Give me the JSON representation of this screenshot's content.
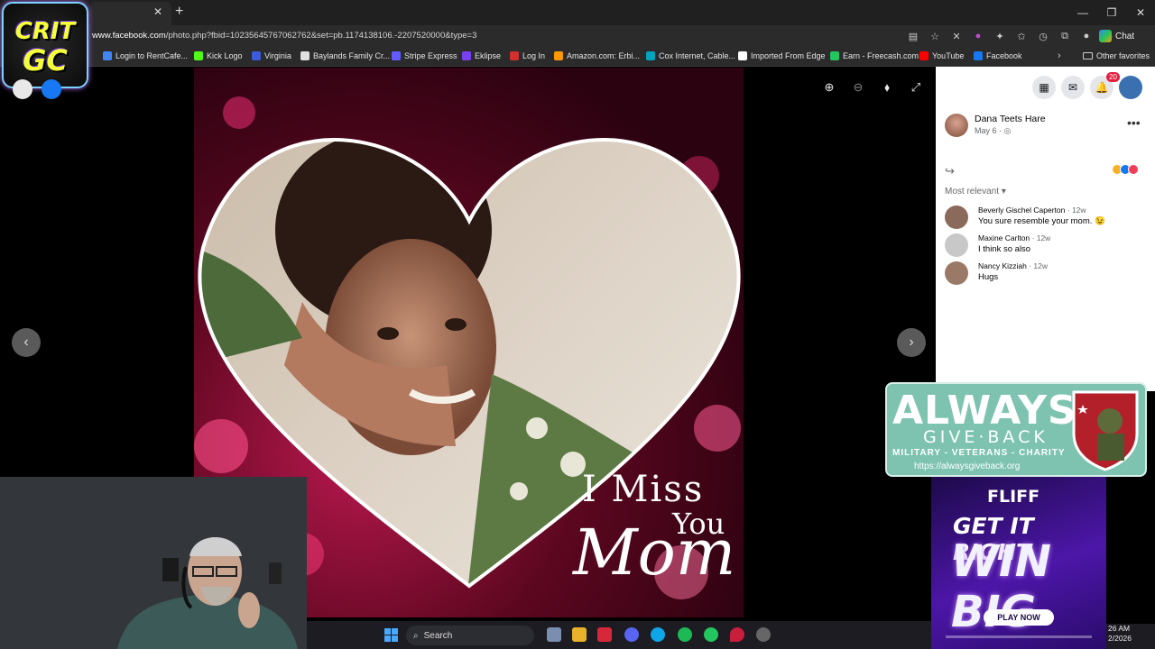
{
  "browser": {
    "url_prefix": "www.facebook.com",
    "url_rest": "/photo.php?fbid=10235645767062762&set=pb.1174138106.-2207520000&type=3",
    "chat_label": "Chat",
    "bookmarks": [
      {
        "label": "Login to RentCafe...",
        "color": "#4285f4"
      },
      {
        "label": "Kick Logo",
        "color": "#53fc18"
      },
      {
        "label": "Virginia",
        "color": "#3b5bdb"
      },
      {
        "label": "Baylands Family Cr...",
        "color": "#e0e0e0"
      },
      {
        "label": "Stripe Express",
        "color": "#635bff"
      },
      {
        "label": "Eklipse",
        "color": "#7b3ff2"
      },
      {
        "label": "Log In",
        "color": "#d32f2f"
      },
      {
        "label": "Amazon.com: Erbi...",
        "color": "#ff9900"
      },
      {
        "label": "Cox Internet, Cable...",
        "color": "#00a4bd"
      },
      {
        "label": "Imported From Edge",
        "color": "#ffffff"
      },
      {
        "label": "Earn - Freecash.com",
        "color": "#22c55e"
      },
      {
        "label": "YouTube",
        "color": "#ff0000"
      },
      {
        "label": "Facebook",
        "color": "#1877f2"
      }
    ],
    "other_favorites": "Other favorites"
  },
  "overlay": {
    "logo_line1": "CRIT",
    "logo_line2": "GC"
  },
  "photo": {
    "line1": "I Miss",
    "line2": "You",
    "line3": "Mom"
  },
  "post": {
    "poster_name": "Dana Teets Hare",
    "date": "May 6 · ",
    "notification_count": "20",
    "sort_label": "Most relevant",
    "comments": [
      {
        "name": "Beverly Gischel Caperton",
        "time": " · 12w",
        "text": "You sure resemble your mom. 😉",
        "avatar": "#8a6a5a"
      },
      {
        "name": "Maxine Carlton",
        "time": " · 12w",
        "text": "I think so also",
        "avatar": "#c8c8c8"
      },
      {
        "name": "Nancy Kizziah",
        "time": " · 12w",
        "text": "Hugs",
        "avatar": "#9a7a66"
      }
    ]
  },
  "ads": {
    "agb_title": "ALWAYS",
    "agb_subtitle": "GIVE·BACK",
    "agb_tagline": "MILITARY - VETERANS - CHARITY",
    "agb_url": "https://alwaysgiveback.org",
    "fliff_logo": "FLIFF",
    "fliff_line1": "GET IT RIGHT",
    "fliff_line2": "WIN BIG",
    "fliff_cta": "PLAY NOW"
  },
  "taskbar": {
    "search_label": "Search",
    "time": "26 AM",
    "date": "2/2026"
  },
  "colors": {
    "fb_blue": "#1877f2",
    "accent_red": "#e41e3f"
  }
}
